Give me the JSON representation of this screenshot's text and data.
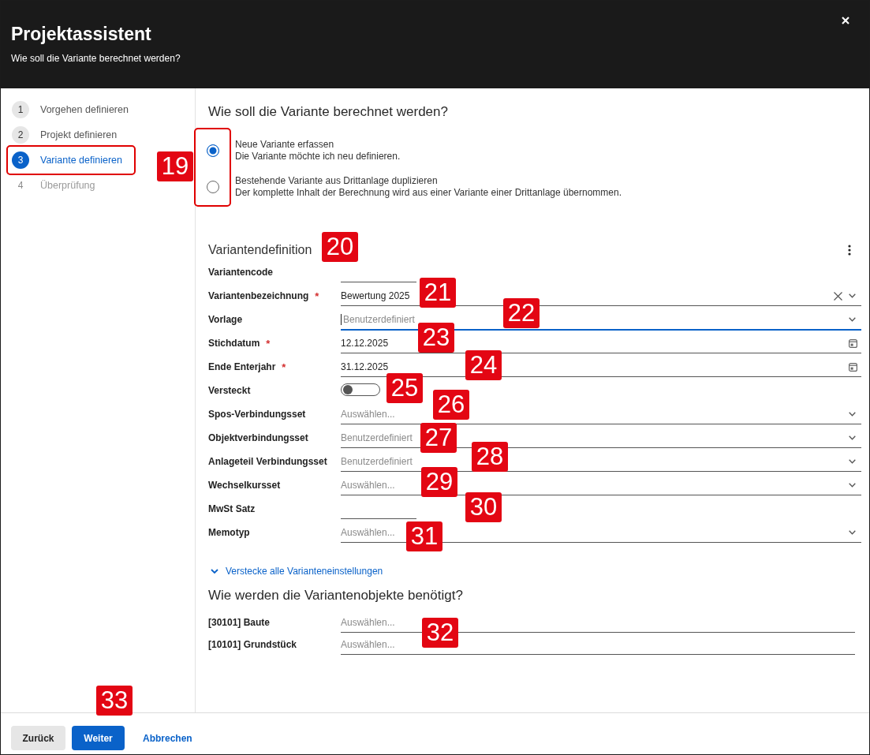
{
  "window": {
    "title": "Projektassistent",
    "subtitle": "Wie soll die Variante berechnet werden?"
  },
  "steps": [
    {
      "number": "1",
      "label": "Vorgehen definieren",
      "selected": false,
      "disabled": false,
      "highlighted": false
    },
    {
      "number": "2",
      "label": "Projekt definieren",
      "selected": false,
      "disabled": false,
      "highlighted": false
    },
    {
      "number": "3",
      "label": "Variante definieren",
      "selected": true,
      "disabled": false,
      "highlighted": true
    },
    {
      "number": "4",
      "label": "Überprüfung",
      "selected": false,
      "disabled": true,
      "highlighted": false
    }
  ],
  "calculation": {
    "heading": "Wie soll die Variante berechnet werden?",
    "highlighted": true,
    "options": [
      {
        "title": "Neue Variante erfassen",
        "description": "Die Variante möchte ich neu definieren.",
        "selected": true
      },
      {
        "title": "Bestehende Variante aus Drittanlage duplizieren",
        "description": "Der komplette Inhalt der Berechnung wird aus einer Variante einer Drittanlage übernommen.",
        "selected": false
      }
    ]
  },
  "definition": {
    "heading": "Variantendefinition",
    "fields": [
      {
        "kind": "short",
        "label": "Variantencode",
        "focused": false,
        "clearable": false
      },
      {
        "kind": "select",
        "label": "Variantenbezeichnung",
        "required_mark": "*",
        "value": "Bewertung 2025",
        "focused": false,
        "clearable": true
      },
      {
        "kind": "select",
        "label": "Vorlage",
        "placeholder": "Benutzerdefiniert",
        "focused": true,
        "clearable": false
      },
      {
        "kind": "date",
        "label": "Stichdatum",
        "required_mark": "*",
        "value": "12.12.2025",
        "focused": false,
        "clearable": false
      },
      {
        "kind": "date",
        "label": "Ende Enterjahr",
        "required_mark": "*",
        "value": "31.12.2025",
        "focused": false,
        "clearable": false
      },
      {
        "kind": "toggle",
        "label": "Versteckt",
        "on": false
      },
      {
        "kind": "select",
        "label": "Spos-Verbindungsset",
        "placeholder": "Auswählen...",
        "focused": false,
        "clearable": false
      },
      {
        "kind": "select",
        "label": "Objektverbindungsset",
        "placeholder": "Benutzerdefiniert",
        "focused": false,
        "clearable": false
      },
      {
        "kind": "select",
        "label": "Anlageteil Verbindungsset",
        "placeholder": "Benutzerdefiniert",
        "focused": false,
        "clearable": false
      },
      {
        "kind": "select",
        "label": "Wechselkursset",
        "placeholder": "Auswählen...",
        "focused": false,
        "clearable": false
      },
      {
        "kind": "short",
        "label": "MwSt Satz",
        "focused": false,
        "clearable": false
      },
      {
        "kind": "select",
        "label": "Memotyp",
        "placeholder": "Auswählen...",
        "focused": false,
        "clearable": false
      }
    ]
  },
  "settings_link": {
    "label": "Verstecke alle Varianteneinstellungen",
    "expanded": true
  },
  "objects": {
    "heading": "Wie werden die Variantenobjekte benötigt?",
    "fields": [
      {
        "label": "[30101] Baute",
        "placeholder": "Auswählen..."
      },
      {
        "label": "[10101] Grundstück",
        "placeholder": "Auswählen..."
      }
    ]
  },
  "footer": {
    "buttons": [
      {
        "label": "Zurück",
        "kind": "secondary"
      },
      {
        "label": "Weiter",
        "kind": "primary"
      },
      {
        "label": "Abbrechen",
        "kind": "link"
      }
    ]
  },
  "callouts": [
    {
      "label": "19"
    },
    {
      "label": "20"
    },
    {
      "label": "21"
    },
    {
      "label": "22"
    },
    {
      "label": "23"
    },
    {
      "label": "24"
    },
    {
      "label": "25"
    },
    {
      "label": "26"
    },
    {
      "label": "27"
    },
    {
      "label": "28"
    },
    {
      "label": "29"
    },
    {
      "label": "30"
    },
    {
      "label": "31"
    },
    {
      "label": "32"
    },
    {
      "label": "33"
    }
  ]
}
